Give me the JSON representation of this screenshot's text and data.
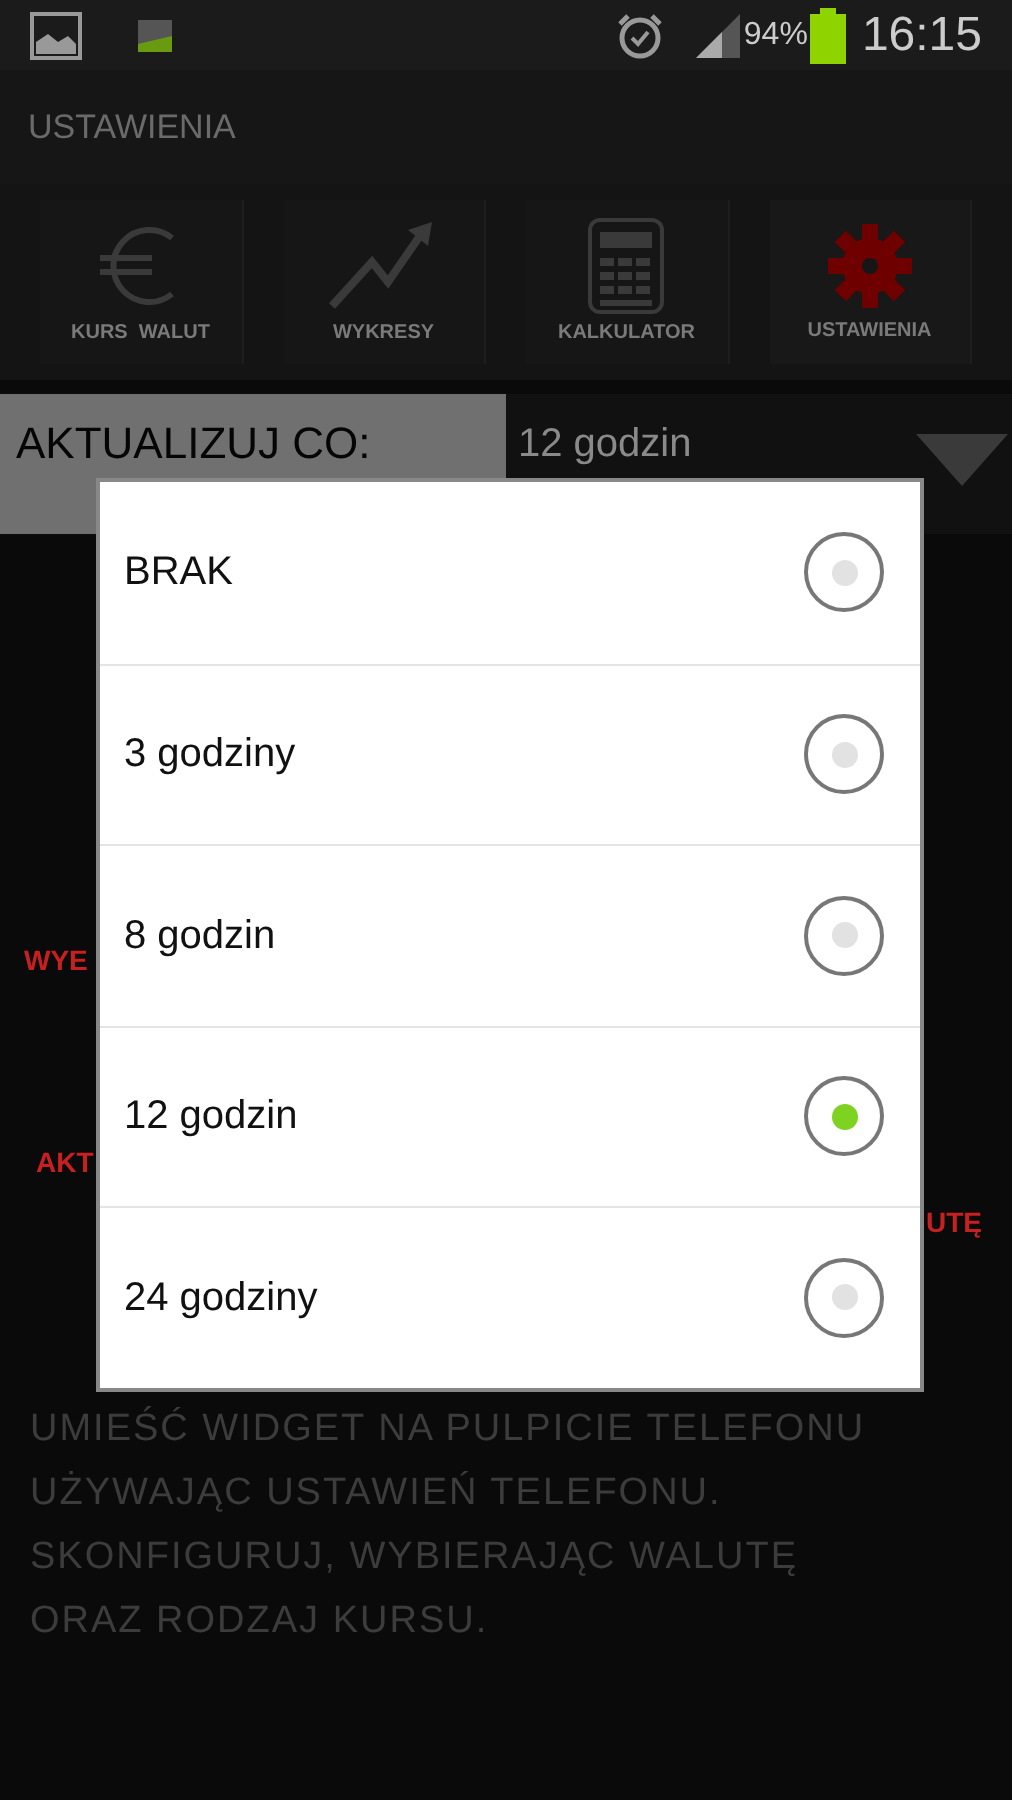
{
  "status_bar": {
    "battery": "94%",
    "time": "16:15"
  },
  "title": "USTAWIENIA",
  "nav": [
    {
      "label": "KURS  WALUT",
      "kind": "euro",
      "selected": false
    },
    {
      "label": "WYKRESY",
      "kind": "chart",
      "selected": false
    },
    {
      "label": "KALKULATOR",
      "kind": "calculator",
      "selected": false
    },
    {
      "label": "USTAWIENIA",
      "kind": "gear",
      "selected": true
    }
  ],
  "update_row": {
    "label": "AKTUALIZUJ CO:",
    "value": "12 godzin"
  },
  "hidden_fragments": [
    "WYE",
    "AKT",
    "UTĘ"
  ],
  "help_text": [
    "UMIEŚĆ WIDGET NA PULPICIE TELEFONU",
    "UŻYWAJĄC USTAWIEŃ TELEFONU.",
    "SKONFIGURUJ, WYBIERAJĄC WALUTĘ",
    "ORAZ RODZAJ KURSU."
  ],
  "dialog": {
    "options": [
      {
        "label": "BRAK",
        "selected": false
      },
      {
        "label": "3 godziny",
        "selected": false
      },
      {
        "label": "8 godzin",
        "selected": false
      },
      {
        "label": "12 godzin",
        "selected": true
      },
      {
        "label": "24 godziny",
        "selected": false
      }
    ]
  }
}
